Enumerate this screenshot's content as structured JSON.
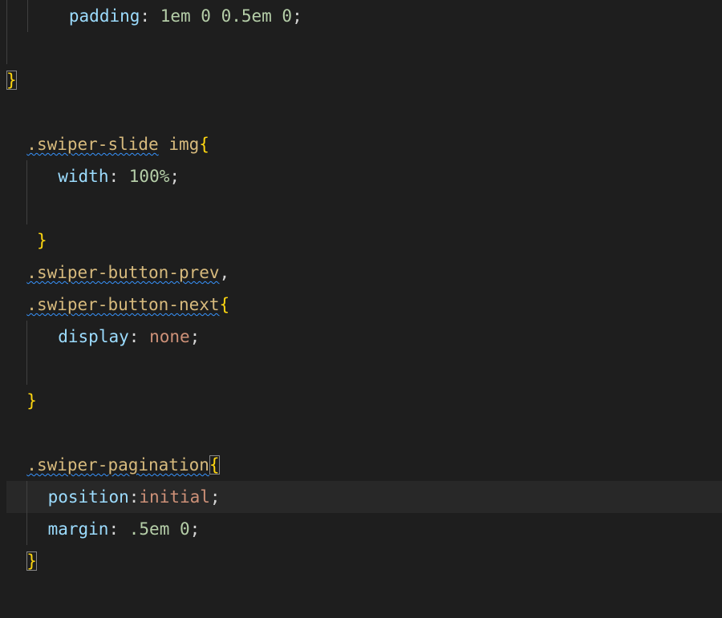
{
  "code": {
    "l1": {
      "prop": "padding",
      "value": "1em 0 0.5em 0"
    },
    "l4": {
      "sel_class": ".swiper-slide",
      "sel_tag": "img"
    },
    "l5": {
      "prop": "width",
      "value": "100%"
    },
    "l8": {
      "sel": ".swiper-button-prev"
    },
    "l9": {
      "sel": ".swiper-button-next"
    },
    "l10": {
      "prop": "display",
      "value": "none"
    },
    "l14": {
      "sel": ".swiper-pagination"
    },
    "l15": {
      "prop": "position",
      "value": "initial"
    },
    "l16": {
      "prop": "margin",
      "value": ".5em 0"
    }
  }
}
